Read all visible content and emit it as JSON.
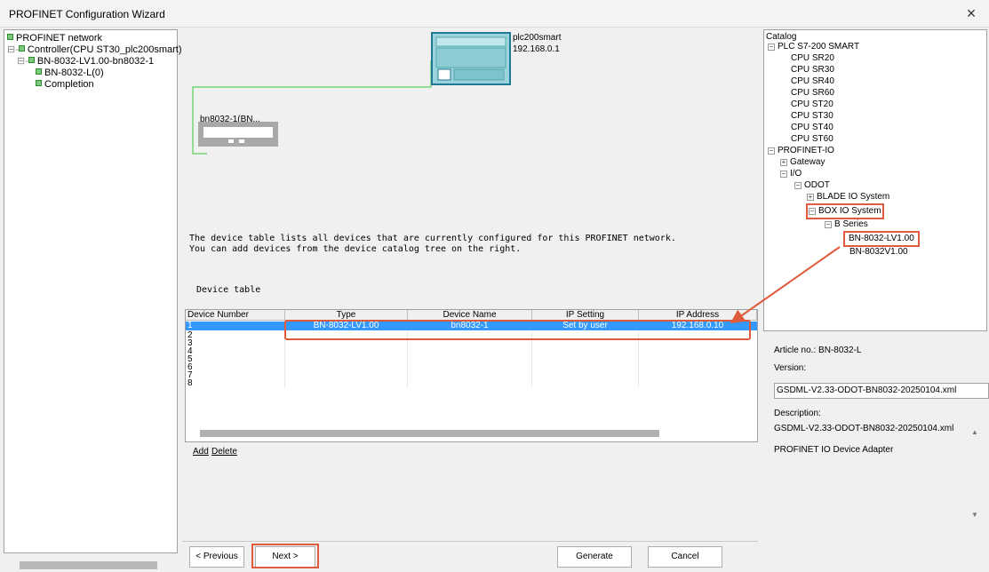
{
  "window": {
    "title": "PROFINET Configuration Wizard",
    "close_glyph": "×"
  },
  "left_tree": {
    "root": "PROFINET network",
    "controller": "Controller(CPU ST30_plc200smart)",
    "device": "BN-8032-LV1.00-bn8032-1",
    "module": "BN-8032-L(0)",
    "completion": "Completion"
  },
  "topology": {
    "plc_name": "plc200smart",
    "plc_ip": "192.168.0.1",
    "device_label": "bn8032-1(BN..."
  },
  "info_text": "The device table lists all devices that are currently configured for this PROFINET network.\nYou can add devices from the device catalog tree on the right.",
  "device_table": {
    "title": "Device table",
    "columns": [
      "Device Number",
      "Type",
      "Device Name",
      "IP Setting",
      "IP Address"
    ],
    "rows": [
      {
        "num": "1",
        "type": "BN-8032-LV1.00",
        "name": "bn8032-1",
        "ip_setting": "Set by user",
        "ip_address": "192.168.0.10"
      },
      {
        "num": "2"
      },
      {
        "num": "3"
      },
      {
        "num": "4"
      },
      {
        "num": "5"
      },
      {
        "num": "6"
      },
      {
        "num": "7"
      },
      {
        "num": "8"
      }
    ],
    "add_label": "Add",
    "delete_label": "Delete"
  },
  "catalog": {
    "title": "Catalog",
    "plc_family": "PLC S7-200 SMART",
    "cpus": [
      "CPU SR20",
      "CPU SR30",
      "CPU SR40",
      "CPU SR60",
      "CPU ST20",
      "CPU ST30",
      "CPU ST40",
      "CPU ST60"
    ],
    "profinet_io": "PROFINET-IO",
    "gateway": "Gateway",
    "io": "I/O",
    "odot": "ODOT",
    "blade": "BLADE IO System",
    "box": "BOX IO System",
    "b_series": "B Series",
    "item_selected": "BN-8032-LV1.00",
    "item_other": "BN-8032V1.00"
  },
  "details": {
    "article_label": "Article no.:",
    "article_value": "BN-8032-L",
    "version_label": "Version:",
    "version_file": "GSDML-V2.33-ODOT-BN8032-20250104.xml",
    "description_label": "Description:",
    "description_file": "GSDML-V2.33-ODOT-BN8032-20250104.xml",
    "description_text": "PROFINET IO Device Adapter",
    "scroll_up": "▲",
    "scroll_down": "▼"
  },
  "buttons": {
    "previous": "< Previous",
    "next": "Next >",
    "generate": "Generate",
    "cancel": "Cancel"
  },
  "colors": {
    "highlight": "#e05a3c",
    "selection": "#3399ff",
    "tree_node": "#7dc97d",
    "link_line": "#39c839"
  }
}
